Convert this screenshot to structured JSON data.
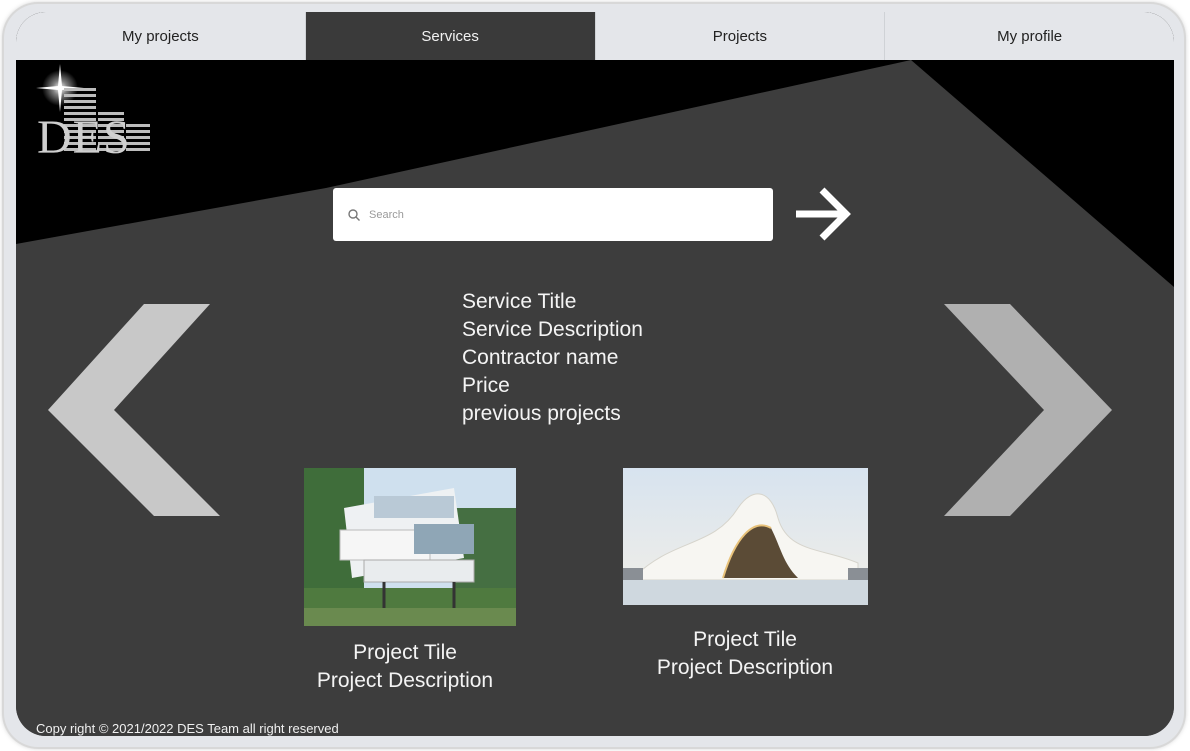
{
  "nav": {
    "tabs": [
      {
        "label": "My projects",
        "active": false
      },
      {
        "label": "Services",
        "active": true
      },
      {
        "label": "Projects",
        "active": false
      },
      {
        "label": "My profile",
        "active": false
      }
    ]
  },
  "logo": {
    "text": "DES"
  },
  "search": {
    "placeholder": "Search",
    "icon": "search-icon"
  },
  "service": {
    "title": "Service Title",
    "description": "Service Description",
    "contractor": "Contractor name",
    "price": "Price",
    "previous_projects": "previous projects"
  },
  "projects": [
    {
      "title": "Project Tile",
      "description": "Project Description"
    },
    {
      "title": "Project Tile",
      "description": "Project Description"
    }
  ],
  "footer": {
    "text": "Copy right © 2021/2022  DES Team all right reserved"
  },
  "colors": {
    "background": "#3d3d3d",
    "banner": "#000000",
    "nav_bg": "#e4e6ea",
    "nav_active": "#3a3a3a",
    "chevron": "#c8c8c8"
  }
}
